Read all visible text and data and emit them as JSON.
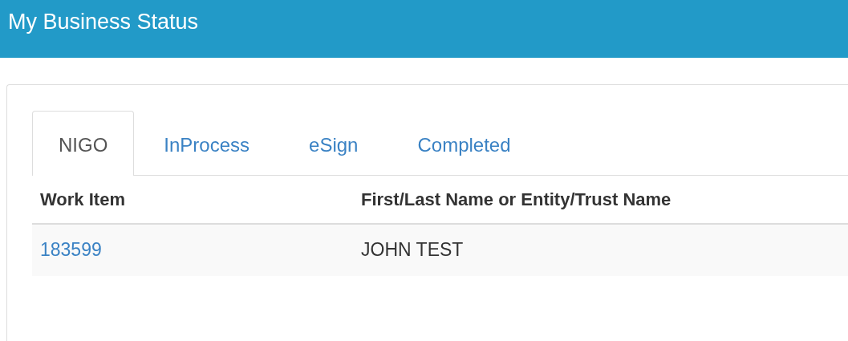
{
  "header": {
    "title": "My Business Status"
  },
  "tabs": [
    {
      "label": "NIGO",
      "selected": true
    },
    {
      "label": "InProcess",
      "selected": false
    },
    {
      "label": "eSign",
      "selected": false
    },
    {
      "label": "Completed",
      "selected": false
    }
  ],
  "table": {
    "columns": [
      "Work Item",
      "First/Last Name or Entity/Trust Name"
    ],
    "rows": [
      {
        "work_item": "183599",
        "name": "JOHN TEST"
      }
    ]
  }
}
